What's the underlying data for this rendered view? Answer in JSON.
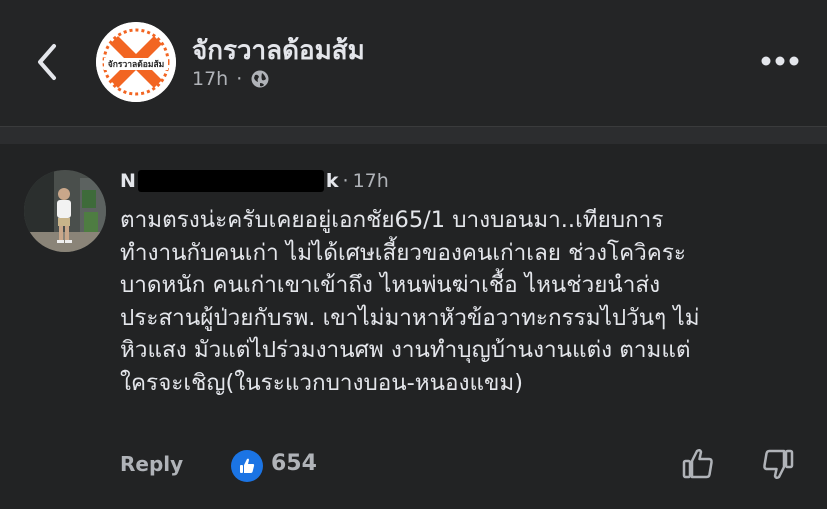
{
  "header": {
    "page_name": "จักรวาลด้อมส้ม",
    "timestamp": "17h",
    "separator": "·",
    "logo_text": "จักรวาลด้อมส้ม",
    "brand_color": "#f26522"
  },
  "comment": {
    "author_start": "N",
    "author_end": "k",
    "separator": "·",
    "timestamp": "17h",
    "text_lines": [
      "ตามตรงน่ะครับเคยอยู่เอกชัย65/1 บางบอนมา..เทียบการ",
      "ทำงานกับคนเก่า ไม่ได้เศษเสี้ยวของคนเก่าเลย ช่วงโควิคระ",
      "บาดหนัก คนเก่าเขาเข้าถึง ไหนพ่นฆ่าเชื้อ ไหนช่วยนำส่ง",
      "ประสานผู้ป่วยกับรพ. เขาไม่มาหาหัวข้อวาทะกรรมไปวันๆ ไม่",
      "หิวแสง มัวแต่ไปร่วมงานศพ งานทำบุญบ้านงานแต่ง ตามแต่",
      "ใครจะเชิญ(ในระแวกบางบอน-หนองแขม)"
    ],
    "reply_label": "Reply",
    "like_count": "654"
  },
  "icons": {
    "back": "chevron-left-icon",
    "more": "more-horizontal-icon",
    "globe": "globe-icon",
    "like": "thumbs-up-icon",
    "dislike": "thumbs-down-icon"
  },
  "colors": {
    "background": "#242526",
    "comment_background": "#222324",
    "like_blue": "#1b74e4",
    "text_primary": "#e4e6eb",
    "text_secondary": "#b0b3b8"
  }
}
